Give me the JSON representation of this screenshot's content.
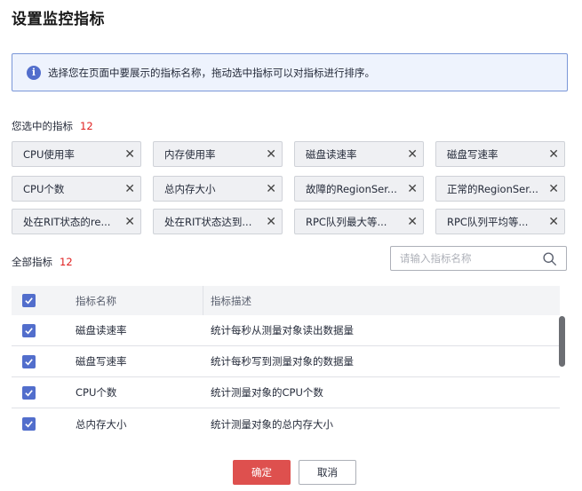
{
  "dialog": {
    "title": "设置监控指标",
    "close_symbol": "ˊ"
  },
  "info": {
    "icon": "info-icon",
    "icon_glyph": "i",
    "text": "选择您在页面中要展示的指标名称，拖动选中指标可以对指标进行排序。"
  },
  "selected": {
    "label": "您选中的指标",
    "count": "12",
    "chips": [
      {
        "label": "CPU使用率"
      },
      {
        "label": "内存使用率"
      },
      {
        "label": "磁盘读速率"
      },
      {
        "label": "磁盘写速率"
      },
      {
        "label": "CPU个数"
      },
      {
        "label": "总内存大小"
      },
      {
        "label": "故障的RegionSer..."
      },
      {
        "label": "正常的RegionSer..."
      },
      {
        "label": "处在RIT状态的re..."
      },
      {
        "label": "处在RIT状态达到..."
      },
      {
        "label": "RPC队列最大等..."
      },
      {
        "label": "RPC队列平均等..."
      }
    ],
    "remove_glyph": "✕"
  },
  "all": {
    "label": "全部指标",
    "count": "12"
  },
  "search": {
    "placeholder": "请输入指标名称",
    "value": ""
  },
  "table": {
    "columns": [
      "指标名称",
      "指标描述"
    ],
    "rows": [
      {
        "name": "磁盘读速率",
        "desc": "统计每秒从测量对象读出数据量",
        "checked": true
      },
      {
        "name": "磁盘写速率",
        "desc": "统计每秒写到测量对象的数据量",
        "checked": true
      },
      {
        "name": "CPU个数",
        "desc": "统计测量对象的CPU个数",
        "checked": true
      },
      {
        "name": "总内存大小",
        "desc": "统计测量对象的总内存大小",
        "checked": true
      }
    ]
  },
  "footer": {
    "ok_label": "确定",
    "cancel_label": "取消"
  },
  "colors": {
    "primary": "#526ecc",
    "danger": "#de504e",
    "count": "#e02020"
  }
}
